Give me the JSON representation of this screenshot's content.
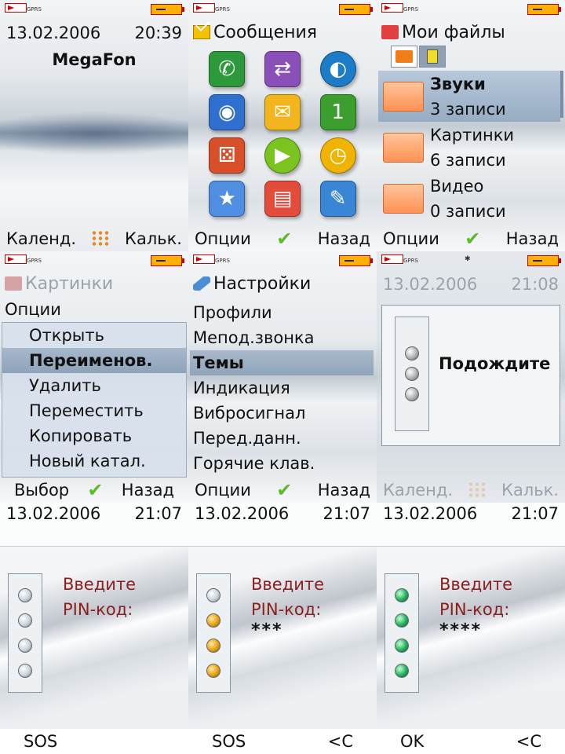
{
  "status": {
    "gprs": "GPRS"
  },
  "standby": {
    "date": "13.02.2006",
    "time": "20:39",
    "operator": "MegaFon",
    "soft_left": "Календ.",
    "soft_right": "Кальк."
  },
  "messages": {
    "title": "Сообщения",
    "apps": [
      "phone-icon",
      "media-icon",
      "internet-icon",
      "camera-icon",
      "messages-icon",
      "organizer-icon",
      "games-icon",
      "player-icon",
      "alarm-icon",
      "entertainment-icon",
      "files-icon",
      "settings-icon"
    ],
    "soft_left": "Опции",
    "soft_right": "Назад"
  },
  "files": {
    "title": "Мои файлы",
    "items": [
      {
        "name": "Звуки",
        "count": "3 записи"
      },
      {
        "name": "Картинки",
        "count": "6 записи"
      },
      {
        "name": "Видео",
        "count": "0 записи"
      }
    ],
    "soft_left": "Опции",
    "soft_right": "Назад"
  },
  "pictures": {
    "title": "Картинки",
    "options_label": "Опции",
    "menu": [
      "Открыть",
      "Переименов.",
      "Удалить",
      "Переместить",
      "Копировать",
      "Новый катал."
    ],
    "soft_left": "Выбор",
    "soft_right": "Назад"
  },
  "settings": {
    "title": "Настройки",
    "items": [
      "Профили",
      "Мепод.звонка",
      "Темы",
      "Индикация",
      "Вибросигнал",
      "Перед.данн.",
      "Горячие клав."
    ],
    "soft_left": "Опции",
    "soft_right": "Назад"
  },
  "wait": {
    "date": "13.02.2006",
    "time": "21:08",
    "message": "Подождите",
    "soft_left": "Календ.",
    "soft_right": "Кальк."
  },
  "pin1": {
    "date": "13.02.2006",
    "time": "21:07",
    "prompt1": "Введите",
    "prompt2": "PIN-код:",
    "value": "",
    "soft_left": "SOS",
    "soft_right": ""
  },
  "pin2": {
    "date": "13.02.2006",
    "time": "21:07",
    "prompt1": "Введите",
    "prompt2": "PIN-код:",
    "value": "***",
    "soft_left": "SOS",
    "soft_right": "<C"
  },
  "pin3": {
    "date": "13.02.2006",
    "time": "21:07",
    "prompt1": "Введите",
    "prompt2": "PIN-код:",
    "value": "****",
    "soft_left": "OK",
    "soft_right": "<C"
  }
}
